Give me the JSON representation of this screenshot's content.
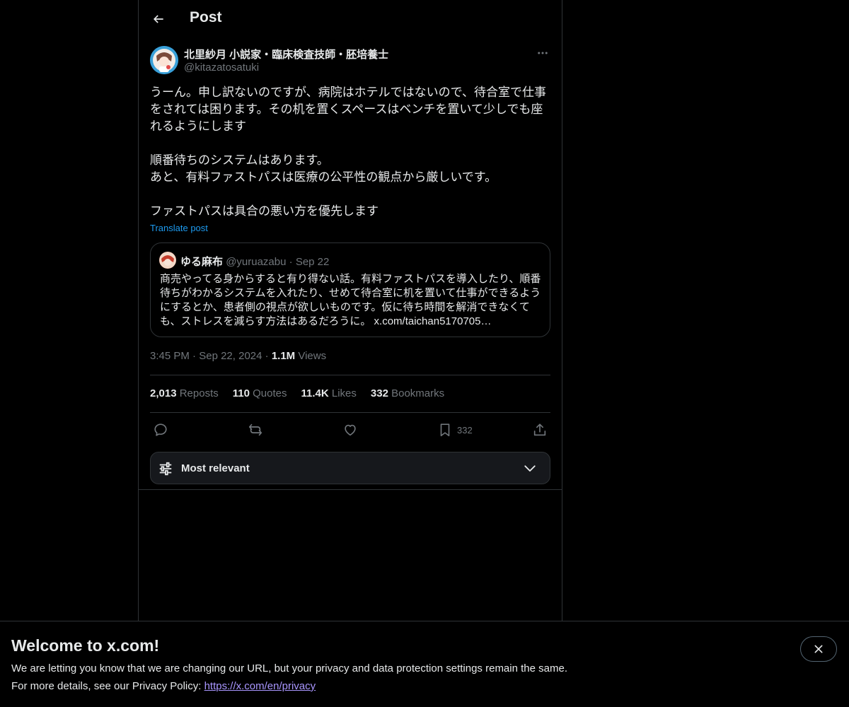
{
  "header": {
    "title": "Post"
  },
  "post": {
    "author_name": "北里紗月 小説家・臨床検査技師・胚培養士",
    "author_handle": "@kitazatosatuki",
    "text": "うーん。申し訳ないのですが、病院はホテルではないので、待合室で仕事\nをされては困ります。その机を置くスペースはベンチを置いて少しでも座\nれるようにします\n\n順番待ちのシステムはあります。\nあと、有料ファストパスは医療の公平性の観点から厳しいです。\n\nファストパスは具合の悪い方を優先します",
    "translate_label": "Translate post",
    "time": "3:45 PM",
    "date": "Sep 22, 2024",
    "separator": "·",
    "views_count": "1.1M",
    "views_label": "Views"
  },
  "quote": {
    "name": "ゆる麻布",
    "handle": "@yuruazabu",
    "separator": "·",
    "date": "Sep 22",
    "text": "商売やってる身からすると有り得ない話。有料ファストパスを導入したり、順番待ちがわかるシステムを入れたり、せめて待合室に机を置いて仕事ができるようにするとか、患者側の視点が欲しいものです。仮に待ち時間を解消できなくても、ストレスを減らす方法はあるだろうに。",
    "link": "x.com/taichan5170705…"
  },
  "stats": {
    "reposts_count": "2,013",
    "reposts_label": "Reposts",
    "quotes_count": "110",
    "quotes_label": "Quotes",
    "likes_count": "11.4K",
    "likes_label": "Likes",
    "bookmarks_count": "332",
    "bookmarks_label": "Bookmarks"
  },
  "actions": {
    "bookmark_count": "332",
    "icons": [
      "reply-icon",
      "repost-icon",
      "like-icon",
      "bookmark-icon",
      "share-icon"
    ]
  },
  "sort": {
    "label": "Most relevant"
  },
  "banner": {
    "title": "Welcome to x.com!",
    "line1": "We are letting you know that we are changing our URL, but your privacy and data protection settings remain the same.",
    "line2_prefix": "For more details, see our Privacy Policy: ",
    "link": "https://x.com/en/privacy"
  },
  "colors": {
    "background": "#000000",
    "text": "#e7e9ea",
    "muted": "#71767b",
    "accent": "#1d9bf0",
    "border": "#2f3336",
    "banner_link": "#a996ff"
  }
}
